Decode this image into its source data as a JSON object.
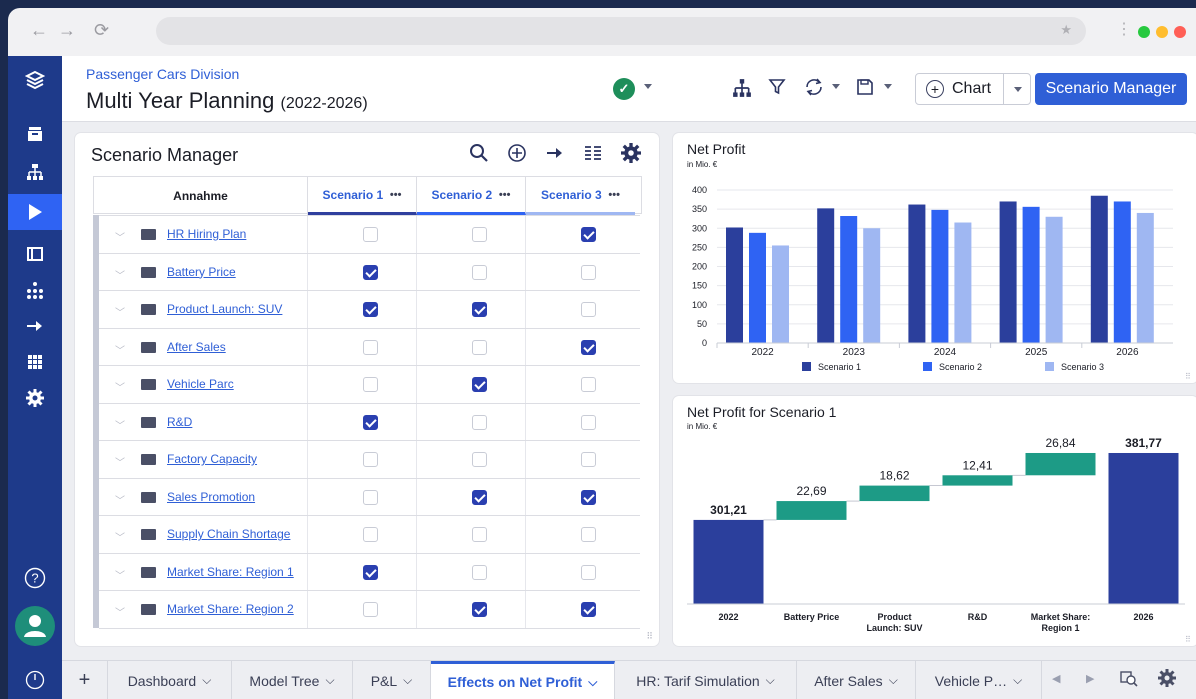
{
  "browser": {
    "back_icon": "arrow-left-icon",
    "forward_icon": "arrow-right-icon",
    "reload_icon": "reload-icon",
    "bookmark_icon": "star-icon",
    "window_dot_colors": [
      "#27c93f",
      "#ffbd2e",
      "#ff5f56"
    ]
  },
  "header": {
    "division": "Passenger Cars Division",
    "title": "Multi Year Planning",
    "title_range": "(2022-2026)",
    "status_icon": "check-circle-icon",
    "chart_button": "Chart",
    "scenario_manager_button": "Scenario Manager"
  },
  "sidebar": {
    "icons": [
      "layers-icon",
      "inbox-icon",
      "hierarchy-icon",
      "play-icon",
      "columns-icon",
      "org-chart-icon",
      "arrow-right-icon",
      "grid-icon",
      "settings-icon",
      "help-icon",
      "user-avatar-icon",
      "power-icon"
    ],
    "active": "play-icon"
  },
  "scenario_panel": {
    "title": "Scenario Manager",
    "col_assumption": "Annahme",
    "scenarios": [
      {
        "label": "Scenario 1",
        "color": "#2f3f9e"
      },
      {
        "label": "Scenario 2",
        "color": "#2f63f3"
      },
      {
        "label": "Scenario 3",
        "color": "#9fb7f2"
      }
    ],
    "more": "•••",
    "rows": [
      {
        "name": "HR Hiring Plan",
        "s1": false,
        "s2": false,
        "s3": true
      },
      {
        "name": "Battery Price",
        "s1": true,
        "s2": false,
        "s3": false
      },
      {
        "name": "Product Launch: SUV",
        "s1": true,
        "s2": true,
        "s3": false
      },
      {
        "name": "After Sales",
        "s1": false,
        "s2": false,
        "s3": true
      },
      {
        "name": "Vehicle Parc",
        "s1": false,
        "s2": true,
        "s3": false
      },
      {
        "name": "R&D",
        "s1": true,
        "s2": false,
        "s3": false
      },
      {
        "name": "Factory Capacity",
        "s1": false,
        "s2": false,
        "s3": false
      },
      {
        "name": "Sales Promotion",
        "s1": false,
        "s2": true,
        "s3": true
      },
      {
        "name": "Supply Chain Shortage",
        "s1": false,
        "s2": false,
        "s3": false
      },
      {
        "name": "Market Share: Region 1",
        "s1": true,
        "s2": false,
        "s3": false
      },
      {
        "name": "Market Share: Region 2",
        "s1": false,
        "s2": true,
        "s3": true
      }
    ]
  },
  "chart_data": [
    {
      "type": "bar",
      "title": "Net Profit",
      "subtitle": "in Mio. €",
      "categories": [
        "2022",
        "2023",
        "2024",
        "2025",
        "2026"
      ],
      "series": [
        {
          "name": "Scenario 1",
          "values": [
            302,
            352,
            362,
            370,
            385
          ],
          "color": "#2b3f9c"
        },
        {
          "name": "Scenario 2",
          "values": [
            288,
            332,
            348,
            356,
            370
          ],
          "color": "#2f63f3"
        },
        {
          "name": "Scenario 3",
          "values": [
            255,
            300,
            315,
            330,
            340
          ],
          "color": "#9fb7f2"
        }
      ],
      "y_ticks": [
        0,
        50,
        100,
        150,
        200,
        250,
        300,
        350,
        400
      ],
      "ylim": [
        0,
        400
      ],
      "grid": true,
      "legend": "bottom"
    },
    {
      "type": "bar",
      "subtype": "waterfall",
      "title": "Net Profit for Scenario 1",
      "subtitle": "in Mio. €",
      "categories": [
        "2022",
        "Battery Price",
        "Product Launch: SUV",
        "R&D",
        "Market Share: Region 1",
        "2026"
      ],
      "category_lines": [
        [
          "2022"
        ],
        [
          "Battery Price"
        ],
        [
          "Product",
          "Launch: SUV"
        ],
        [
          "R&D"
        ],
        [
          "Market Share:",
          "Region 1"
        ],
        [
          "2026"
        ]
      ],
      "values": [
        301.21,
        22.69,
        18.62,
        12.41,
        26.84,
        381.77
      ],
      "labels": [
        "301,21",
        "22,69",
        "18,62",
        "12,41",
        "26,84",
        "381,77"
      ],
      "kinds": [
        "total",
        "delta",
        "delta",
        "delta",
        "delta",
        "total"
      ],
      "colors": {
        "total": "#2b3f9c",
        "delta": "#1d9b86"
      },
      "ylim": [
        200,
        395
      ]
    }
  ],
  "tabs": [
    {
      "label": "Dashboard"
    },
    {
      "label": "Model Tree"
    },
    {
      "label": "P&L"
    },
    {
      "label": "Effects on Net Profit",
      "active": true
    },
    {
      "label": "HR: Tarif Simulation"
    },
    {
      "label": "After Sales"
    },
    {
      "label": "Vehicle P…"
    }
  ],
  "tab_add": "+"
}
